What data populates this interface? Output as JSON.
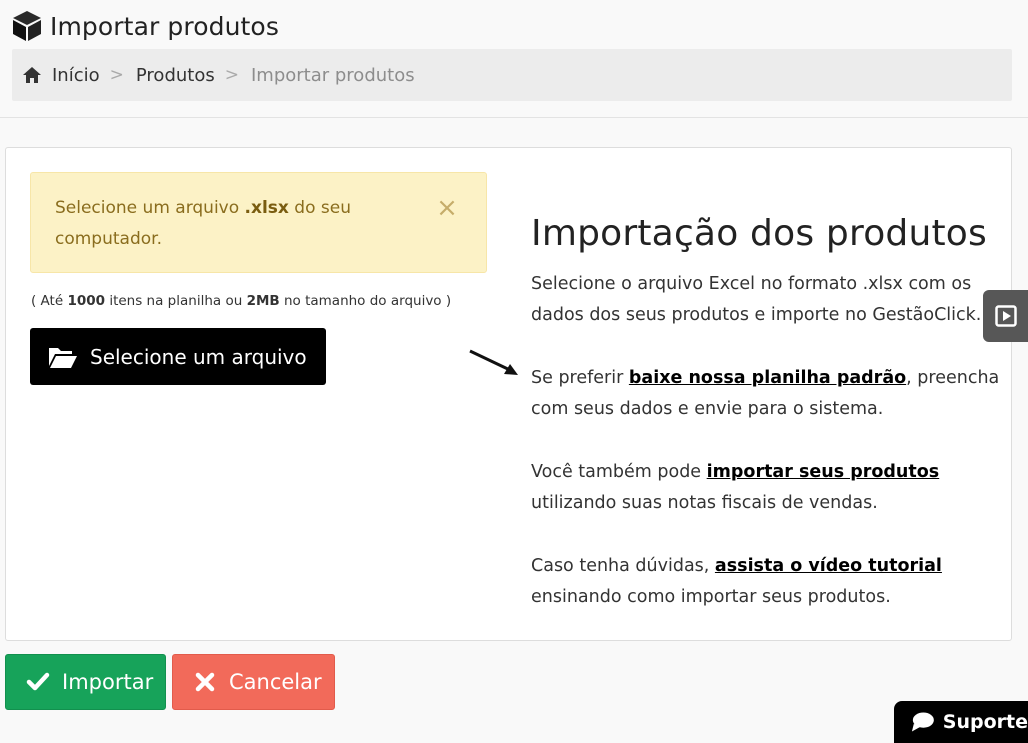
{
  "header": {
    "title": "Importar produtos",
    "title_icon": "cube-icon"
  },
  "breadcrumb": {
    "home_icon": "home-icon",
    "items": [
      "Início",
      "Produtos",
      "Importar produtos"
    ],
    "separator": ">"
  },
  "alert": {
    "text_before": "Selecione um arquivo ",
    "text_bold": ".xlsx",
    "text_after": " do seu computador.",
    "close_label": "×"
  },
  "limit_note": {
    "part1": "( Até ",
    "items_count": "1000",
    "part2": " itens na planilha ou ",
    "size_limit": "2MB",
    "part3": " no tamanho do arquivo )"
  },
  "select_button": {
    "label": "Selecione um arquivo",
    "icon": "folder-open-icon"
  },
  "info": {
    "heading": "Importação dos produtos",
    "p1": "Selecione o arquivo Excel no formato .xlsx com os dados dos seus produtos e importe no GestãoClick.",
    "p2_before": "Se preferir ",
    "p2_link": "baixe nossa planilha padrão",
    "p2_after": ", preencha com seus dados e envie para o sistema.",
    "p3_before": "Você também pode ",
    "p3_link": "importar seus produtos",
    "p3_after": " utilizando suas notas fiscais de vendas.",
    "p4_before": "Caso tenha dúvidas, ",
    "p4_link": "assista o vídeo tutorial",
    "p4_after": " ensinando como importar seus produtos."
  },
  "actions": {
    "import_label": "Importar",
    "cancel_label": "Cancelar"
  },
  "support": {
    "label": "Suporte"
  },
  "colors": {
    "import_green": "#17a35a",
    "cancel_red": "#f26a5a",
    "alert_bg": "#fcf2c6"
  }
}
